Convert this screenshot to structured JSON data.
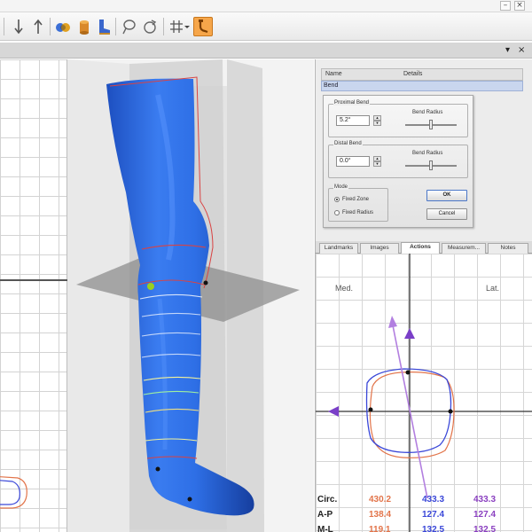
{
  "window": {
    "minimize_glyph": "–",
    "close_glyph": "×"
  },
  "toolbar": {
    "icons": [
      "down-arrow-icon",
      "up-arrow-icon",
      "spheres-icon",
      "cylinder-icon",
      "boot-icon",
      "lasso-icon",
      "rotate-icon",
      "grid-icon",
      "bend-icon"
    ],
    "active_icon": "bend-icon",
    "accent_color": "#f6a64a"
  },
  "panel_controls": {
    "pin_glyph": "▾",
    "close_glyph": "×"
  },
  "list": {
    "col_name": "Name",
    "col_details": "Details",
    "selected_row": "Bend"
  },
  "bend_dialog": {
    "proximal_label": "Proximal Bend",
    "proximal_value": "5.2°",
    "proximal_radius_label": "Bend Radius",
    "proximal_radius_level": 0.5,
    "distal_label": "Distal Bend",
    "distal_value": "0.0°",
    "distal_radius_label": "Bend Radius",
    "distal_radius_level": 0.5,
    "mode_label": "Mode",
    "mode_options": [
      "Fixed Zone",
      "Fixed Radius"
    ],
    "mode_selected": "Fixed Zone",
    "ok_label": "OK",
    "cancel_label": "Cancel"
  },
  "tabs": [
    {
      "label": "Landmarks",
      "active": false
    },
    {
      "label": "Images",
      "active": false
    },
    {
      "label": "Actions",
      "active": true
    },
    {
      "label": "Measurem...",
      "active": false
    },
    {
      "label": "Notes",
      "active": false
    }
  ],
  "section": {
    "med_label": "Med.",
    "lat_label": "Lat.",
    "colors": {
      "original": "#e2744a",
      "modified": "#3a47d8",
      "axis_marker": "#7a3fc8",
      "vector": "#b27fe0"
    }
  },
  "measurements": {
    "rows": [
      {
        "label": "Circ.",
        "values": [
          "430.2",
          "433.3",
          "433.3"
        ]
      },
      {
        "label": "A-P",
        "values": [
          "138.4",
          "127.4",
          "127.4"
        ]
      },
      {
        "label": "M-L",
        "values": [
          "119.1",
          "132.5",
          "132.5"
        ]
      }
    ],
    "column_colors": [
      "#e2744a",
      "#3a47d8",
      "#8a3fc0"
    ]
  },
  "model": {
    "surface_color": "#2e6fe6"
  }
}
